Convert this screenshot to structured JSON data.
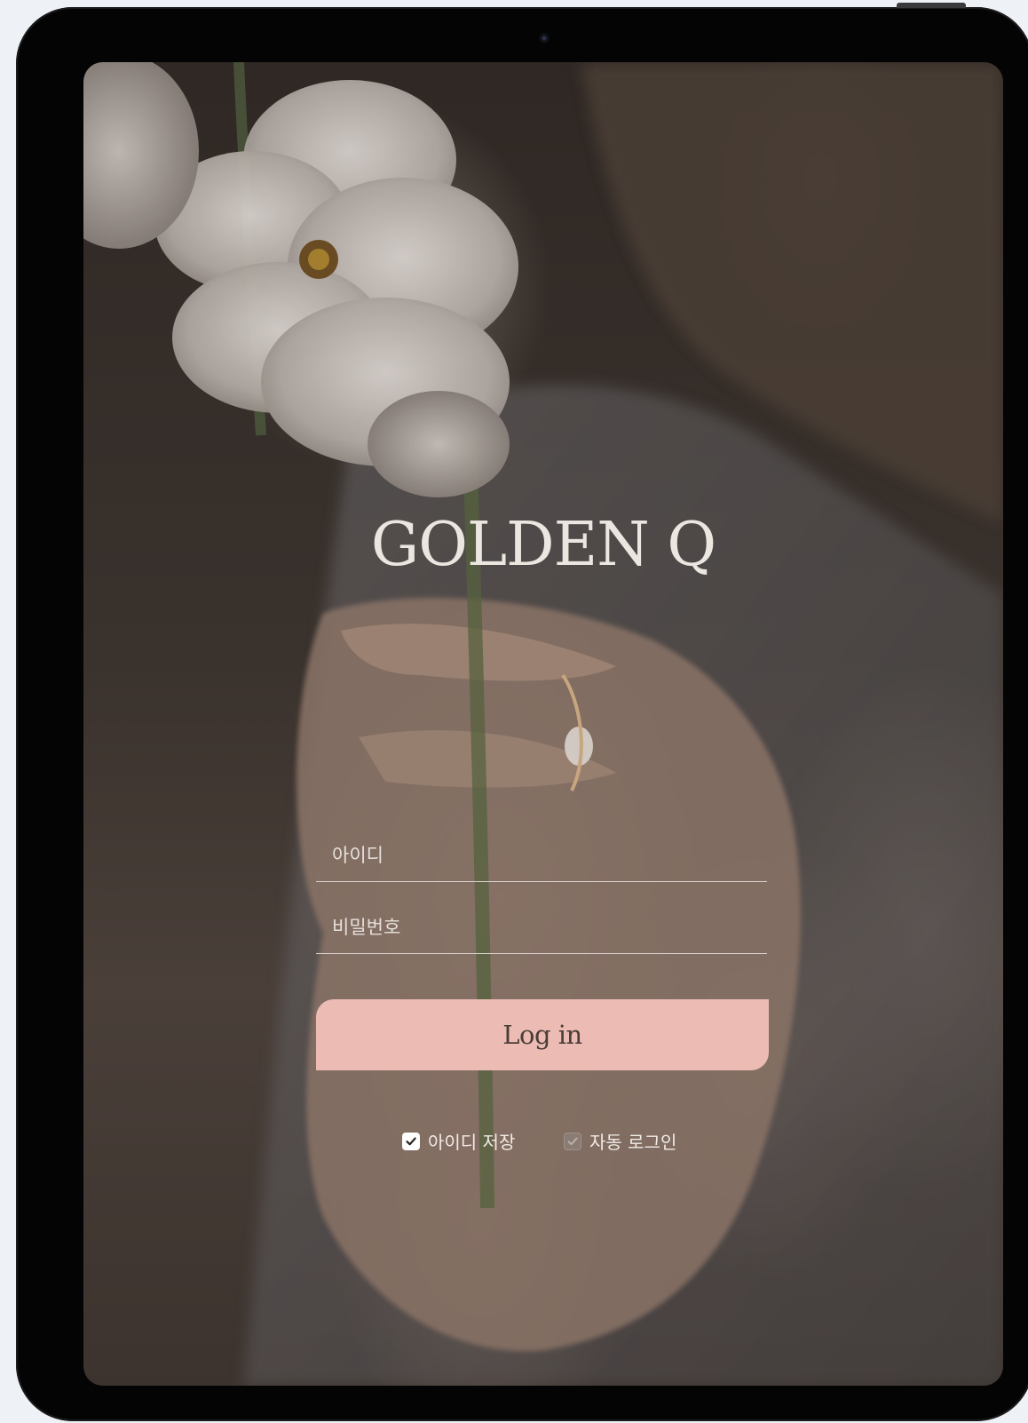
{
  "brand": {
    "logo_text": "GOLDEN Q"
  },
  "login_form": {
    "id_placeholder": "아이디",
    "password_placeholder": "비밀번호",
    "login_label": "Log in"
  },
  "options": {
    "save_id": {
      "label": "아이디 저장",
      "checked": true
    },
    "auto_login": {
      "label": "자동 로그인",
      "checked": false
    }
  },
  "colors": {
    "login_button": "#ecbcb4",
    "login_text": "#4a3d38",
    "device_frame": "#040404",
    "page_background": "#eef1f6"
  },
  "icons": [
    "camera-icon",
    "checkmark-icon"
  ]
}
